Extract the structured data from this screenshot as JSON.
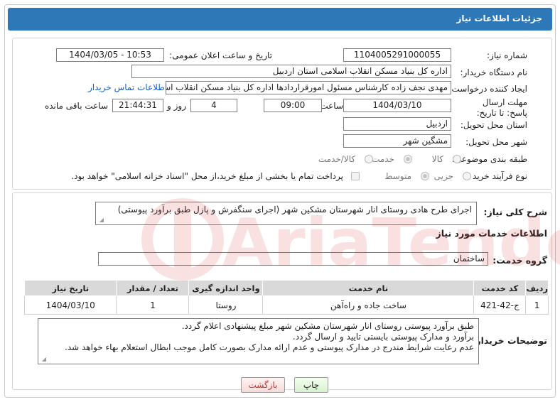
{
  "header": {
    "title": "جزئیات اطلاعات نیاز"
  },
  "form": {
    "need_number_label": "شماره نیاز:",
    "need_number": "1104005291000055",
    "announce_label": "تاریخ و ساعت اعلان عمومی:",
    "announce_value": "1404/03/05 - 10:53",
    "buyer_org_label": "نام دستگاه خریدار:",
    "buyer_org": "اداره کل بنیاد مسکن انقلاب اسلامی استان اردبیل",
    "creator_label": "ایجاد کننده درخواست:",
    "creator": "مهدی نجف زاده کارشناس مسئول امورقراردادها اداره کل بنیاد مسکن انقلاب اسلامی استان اردبیل",
    "contact_link": "اطلاعات تماس خریدار",
    "deadline_label": "مهلت ارسال پاسخ: تا تاریخ:",
    "deadline_date": "1404/03/10",
    "time_label": "ساعت",
    "deadline_time": "09:00",
    "days_value": "4",
    "days_label": "روز و",
    "remaining_time": "21:44:31",
    "remaining_label": "ساعت باقی مانده",
    "province_label": "استان محل تحویل:",
    "province": "اردبیل",
    "city_label": "شهر محل تحویل:",
    "city": "مشگین شهر",
    "category_label": "طبقه بندی موضوعی:",
    "category_options": [
      "کالا",
      "خدمت",
      "کالا/خدمت"
    ],
    "category_selected": "خدمت",
    "process_label": "نوع فرآیند خرید :",
    "process_options": [
      "جزیی",
      "متوسط"
    ],
    "process_selected": "متوسط",
    "payment_note": "پرداخت تمام یا بخشی از مبلغ خرید،از محل \"اسناد خزانه اسلامی\" خواهد بود."
  },
  "summary": {
    "label": "شرح کلی نیاز:",
    "text": "اجرای طرح هادی روستای انار شهرستان مشکین شهر (اجرای سنگفرش و پازل طبق برآورد  پیوستی)"
  },
  "services": {
    "section_title": "اطلاعات خدمات مورد نیاز",
    "group_label": "گروه خدمت:",
    "group_value": "ساختمان",
    "columns": [
      "ردیف",
      "کد خدمت",
      "نام خدمت",
      "واحد اندازه گیری",
      "تعداد / مقدار",
      "تاریخ نیاز"
    ],
    "rows": [
      {
        "row": "1",
        "code": "ج-42-421",
        "name": "ساخت جاده و راه‌آهن",
        "unit": "روستا",
        "qty": "1",
        "date": "1404/03/10"
      }
    ]
  },
  "buyer_notes": {
    "label": "توضیحات خریدار:",
    "lines": [
      "طبق برآورد پیوستی روستای انار شهرستان مشکین شهر مبلغ پیشنهادی اعلام گردد.",
      "برآورد و مدارک پیوستی بایستی تایید و ارسال گردد.",
      "عدم رعایت شرایط مندرج در مدارک پیوستی و عدم ارائه مدارک بصورت کامل موجب ابطال استعلام بهاء خواهد شد."
    ]
  },
  "buttons": {
    "print": "چاپ",
    "back": "بازگشت"
  },
  "watermark": {
    "text": "AriaTender.net"
  },
  "colors": {
    "header": "#2e78b7",
    "link": "#1f5fbf",
    "back_text": "#c0392b"
  }
}
